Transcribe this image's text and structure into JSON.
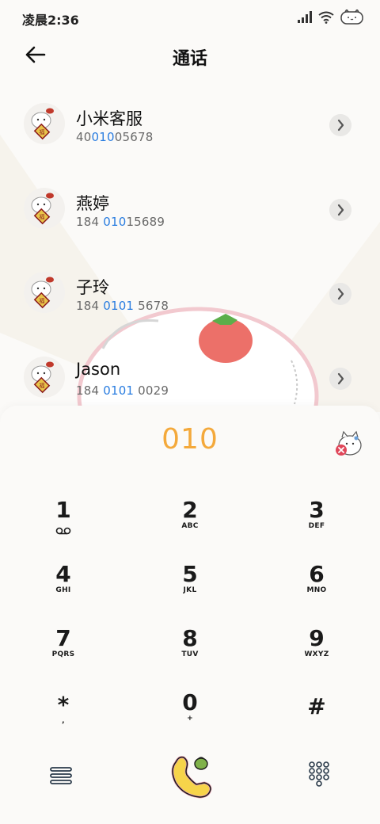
{
  "status_bar": {
    "time": "凌晨2:36"
  },
  "header": {
    "title": "通话"
  },
  "contacts": [
    {
      "name": "小米客服",
      "number_pre": "40",
      "number_hl": "010",
      "number_post": "05678"
    },
    {
      "name": "燕婷",
      "number_pre": "184 ",
      "number_hl": "010",
      "number_post": "15689"
    },
    {
      "name": "子玲",
      "number_pre": "184 ",
      "number_hl": "0101",
      "number_post": " 5678"
    },
    {
      "name": "Jason",
      "number_pre": "184 ",
      "number_hl": "0101",
      "number_post": " 0029"
    }
  ],
  "dialer": {
    "entered_number": "010",
    "keys": [
      {
        "digit": "1",
        "letters": ""
      },
      {
        "digit": "2",
        "letters": "ABC"
      },
      {
        "digit": "3",
        "letters": "DEF"
      },
      {
        "digit": "4",
        "letters": "GHI"
      },
      {
        "digit": "5",
        "letters": "JKL"
      },
      {
        "digit": "6",
        "letters": "MNO"
      },
      {
        "digit": "7",
        "letters": "PQRS"
      },
      {
        "digit": "8",
        "letters": "TUV"
      },
      {
        "digit": "9",
        "letters": "WXYZ"
      },
      {
        "digit": "*",
        "letters": ","
      },
      {
        "digit": "0",
        "letters": "+"
      },
      {
        "digit": "#",
        "letters": ""
      }
    ]
  },
  "colors": {
    "highlight": "#2a7de0",
    "dial_number": "#f4a93b",
    "call_button": "#f6d44a"
  }
}
